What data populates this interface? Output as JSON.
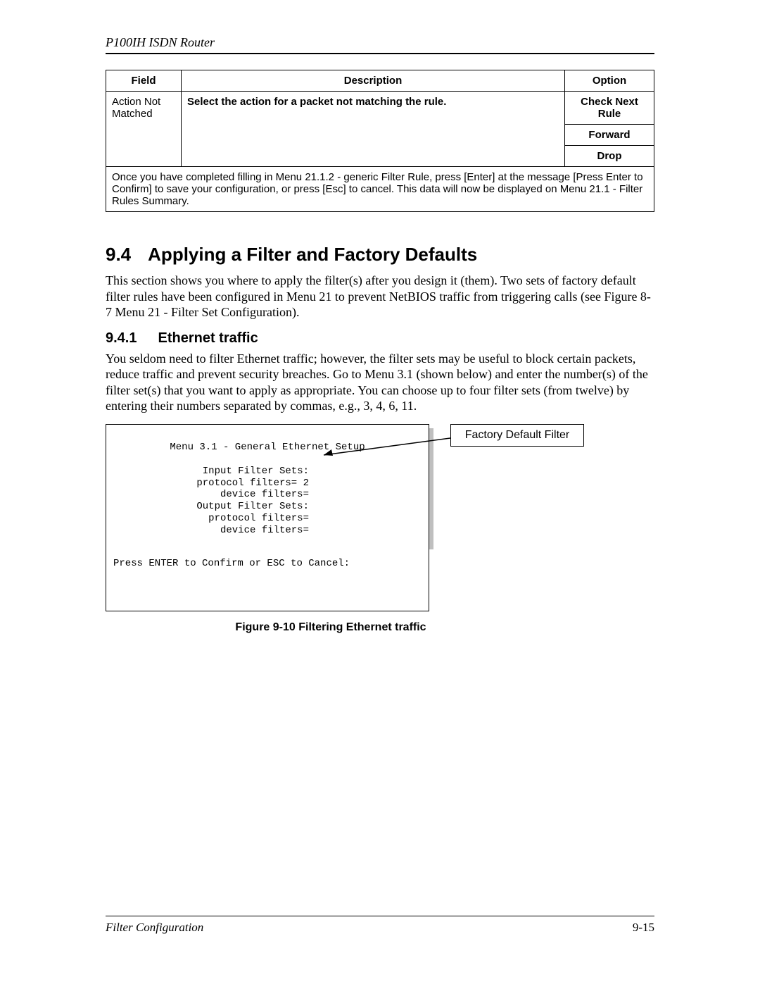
{
  "header": {
    "running": "P100IH ISDN Router"
  },
  "table": {
    "headers": {
      "field": "Field",
      "description": "Description",
      "option": "Option"
    },
    "row": {
      "field": "Action Not Matched",
      "description": "Select the action for a packet not matching the rule.",
      "options": [
        "Check Next Rule",
        "Forward",
        "Drop"
      ]
    },
    "note": "Once you have completed filling in Menu 21.1.2 - generic Filter Rule, press [Enter] at the message [Press Enter to Confirm] to save your configuration, or press [Esc] to cancel. This data will now be displayed on Menu 21.1 - Filter Rules Summary."
  },
  "section": {
    "num": "9.4",
    "title": "Applying a Filter and Factory Defaults",
    "para": "This section shows you where to apply the filter(s) after you design it (them). Two sets of factory default filter rules have been configured in Menu 21 to prevent NetBIOS traffic from triggering calls (see Figure 8-7 Menu 21 - Filter Set Configuration)."
  },
  "subsection": {
    "num": "9.4.1",
    "title": "Ethernet traffic",
    "para": "You seldom need to filter Ethernet traffic; however, the filter sets may be useful to block certain packets, reduce traffic and prevent security breaches. Go to Menu 3.1 (shown below) and enter the number(s) of the filter set(s) that you want to apply as appropriate. You can choose up to four filter sets (from twelve) by entering their numbers separated by commas, e.g., 3, 4, 6, 11."
  },
  "terminal": {
    "title": "Menu 3.1 - General Ethernet Setup",
    "lines": [
      "Input Filter Sets:",
      "protocol filters= 2",
      "device filters=",
      "Output Filter Sets:",
      "protocol filters=",
      "device filters="
    ],
    "footer": "Press ENTER to Confirm or ESC to Cancel:"
  },
  "callout": "Factory Default Filter",
  "figure_caption": "Figure 9-10 Filtering Ethernet traffic",
  "footer": {
    "left": "Filter Configuration",
    "right": "9-15"
  }
}
